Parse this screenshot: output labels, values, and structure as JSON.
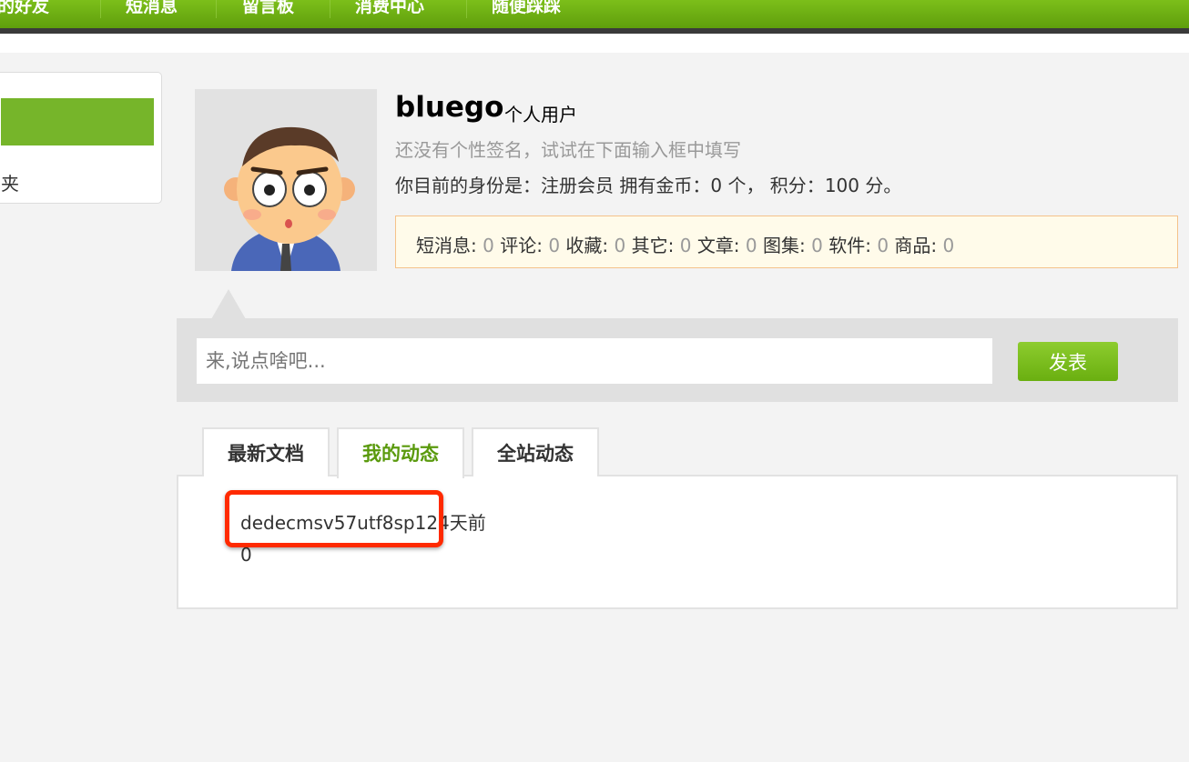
{
  "nav": {
    "items": [
      "我的好友",
      "短消息",
      "留言板",
      "消费中心",
      "随便踩踩"
    ]
  },
  "sidebar": {
    "partial_label": "夹"
  },
  "profile": {
    "username": "bluego",
    "user_type": "个人用户",
    "signature": "还没有个性签名，试试在下面输入框中填写",
    "identity_prefix": "你目前的身份是：注册会员 拥有金币：",
    "gold": "0",
    "identity_mid": " 个， 积分：",
    "points": "100",
    "identity_suffix": " 分。"
  },
  "stats": [
    {
      "label": "短消息:",
      "value": "0"
    },
    {
      "label": "评论:",
      "value": "0"
    },
    {
      "label": "收藏:",
      "value": "0"
    },
    {
      "label": "其它:",
      "value": "0"
    },
    {
      "label": "文章:",
      "value": "0"
    },
    {
      "label": "图集:",
      "value": "0"
    },
    {
      "label": "软件:",
      "value": "0"
    },
    {
      "label": "商品:",
      "value": "0"
    }
  ],
  "post": {
    "placeholder": "来,说点啥吧...",
    "submit_label": "发表"
  },
  "tabs": [
    {
      "label": "最新文档"
    },
    {
      "label": "我的动态"
    },
    {
      "label": "全站动态"
    }
  ],
  "feed": {
    "item_title": "dedecmsv57utf8sp1",
    "item_time": "24天前",
    "item_count": "0"
  },
  "colors": {
    "brand_green": "#6aaf10",
    "highlight_red": "#ff2a00",
    "active_tab": "#5a9a0d"
  }
}
